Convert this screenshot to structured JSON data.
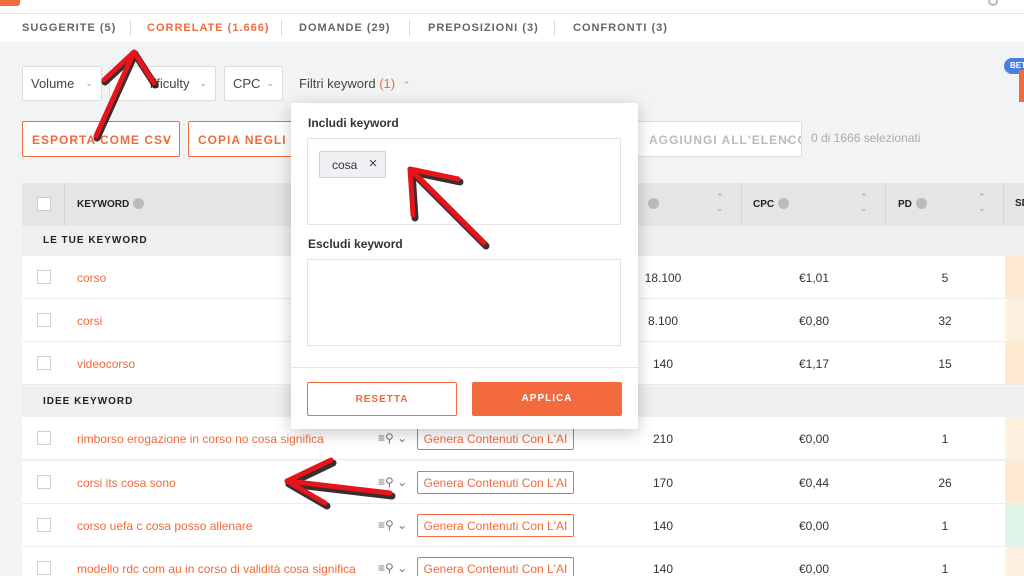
{
  "tabs": [
    {
      "label": "SUGGERITE (5)",
      "active": false
    },
    {
      "label": "CORRELATE (1.666)",
      "active": true
    },
    {
      "label": "DOMANDE (29)",
      "active": false
    },
    {
      "label": "PREPOSIZIONI (3)",
      "active": false
    },
    {
      "label": "CONFRONTI (3)",
      "active": false
    }
  ],
  "filters": {
    "volume": "Volume",
    "difficulty": "Difficulty",
    "difficulty_visible": "ifficulty",
    "cpc": "CPC",
    "keyword_filter": "Filtri keyword",
    "keyword_filter_count": "(1)",
    "beta": "BET"
  },
  "actions": {
    "export_csv": "ESPORTA COME CSV",
    "copy": "COPIA NEGLI A",
    "add_to_list": "AGGIUNGI ALL'ELENCO",
    "selected": "0 di 1666 selezionati"
  },
  "table": {
    "headers": {
      "keyword": "KEYWORD",
      "cpc": "CPC",
      "pd": "PD",
      "sd": "SD"
    },
    "section_own": "LE TUE KEYWORD",
    "section_ideas": "IDEE KEYWORD",
    "own_rows": [
      {
        "keyword": "corso",
        "volume": "18.100",
        "cpc": "€1,01",
        "pd": "5"
      },
      {
        "keyword": "corsi",
        "volume": "8.100",
        "cpc": "€0,80",
        "pd": "32"
      },
      {
        "keyword": "videocorso",
        "volume": "140",
        "cpc": "€1,17",
        "pd": "15"
      }
    ],
    "idea_rows": [
      {
        "keyword": "rimborso erogazione in corso no cosa significa",
        "volume": "210",
        "cpc": "€0,00",
        "pd": "1",
        "generate": "Genera Contenuti Con L'AI"
      },
      {
        "keyword": "corsi its cosa sono",
        "volume": "170",
        "cpc": "€0,44",
        "pd": "26",
        "generate": "Genera Contenuti Con L'AI"
      },
      {
        "keyword": "corso uefa c cosa posso allenare",
        "volume": "140",
        "cpc": "€0,00",
        "pd": "1",
        "generate": "Genera Contenuti Con L'AI"
      },
      {
        "keyword": "modello rdc com au in corso di validità cosa significa",
        "volume": "140",
        "cpc": "€0,00",
        "pd": "1",
        "generate": "Genera Contenuti Con L'AI"
      }
    ]
  },
  "popup": {
    "include_label": "Includi keyword",
    "include_chip": "cosa",
    "exclude_label": "Escludi keyword",
    "reset": "RESETTA",
    "apply": "APPLICA"
  },
  "colors": {
    "accent": "#f26a3d",
    "annotation": "#e8141c"
  }
}
